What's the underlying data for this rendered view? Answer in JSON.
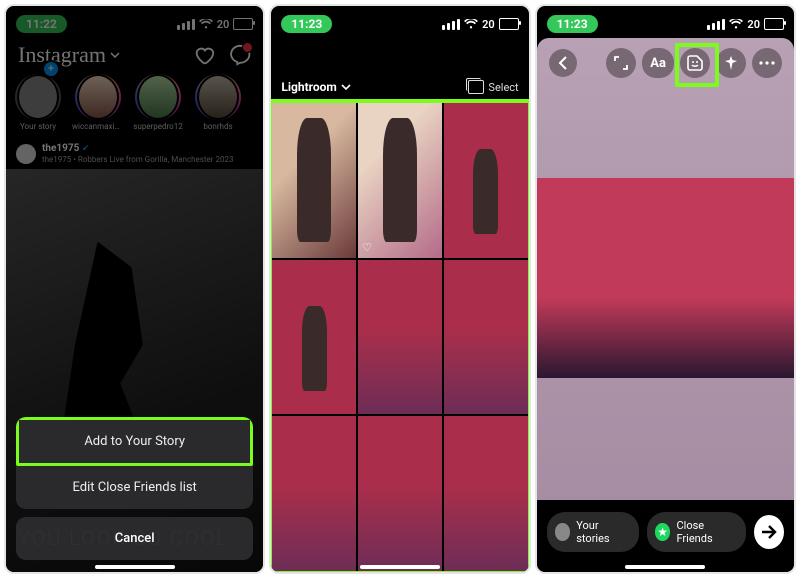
{
  "panel1": {
    "status_time": "11:22",
    "battery_pct": "20",
    "logo": "Instagram",
    "stories": [
      {
        "label": "Your story",
        "ring": "none",
        "has_plus": true
      },
      {
        "label": "wiccanmaximoffx",
        "ring": "grad"
      },
      {
        "label": "superpedro12",
        "ring": "grad"
      },
      {
        "label": "bonrhds",
        "ring": "grad"
      }
    ],
    "post_user": "the1975",
    "post_caption": "the1975 • Robbers Live from Gorilla, Manchester 2023",
    "feed_overlay_text": "YOU LOOK SO COOL",
    "sheet": {
      "add_story": "Add to Your Story",
      "edit_cf": "Edit Close Friends list",
      "cancel": "Cancel"
    }
  },
  "panel2": {
    "status_time": "11:23",
    "battery_pct": "20",
    "album_name": "Lightroom",
    "select_label": "Select"
  },
  "panel3": {
    "status_time": "11:23",
    "battery_pct": "20",
    "text_tool_label": "Aa",
    "your_stories_label": "Your stories",
    "close_friends_label": "Close Friends"
  }
}
